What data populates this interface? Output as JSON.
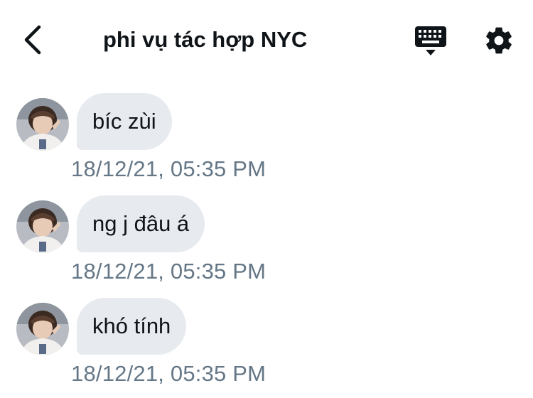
{
  "header": {
    "title": "phi vụ tác hợp NYC",
    "back_icon": "chevron-left-icon",
    "keyboard_icon": "keyboard-icon",
    "settings_icon": "gear-icon"
  },
  "messages": [
    {
      "text": "bíc zùi",
      "timestamp": "18/12/21, 05:35 PM"
    },
    {
      "text": "ng j đâu á",
      "timestamp": "18/12/21, 05:35 PM"
    },
    {
      "text": "khó tính",
      "timestamp": "18/12/21, 05:35 PM"
    }
  ],
  "colors": {
    "bubble_bg": "#e7eaee",
    "timestamp": "#657786",
    "text": "#0f1419"
  }
}
